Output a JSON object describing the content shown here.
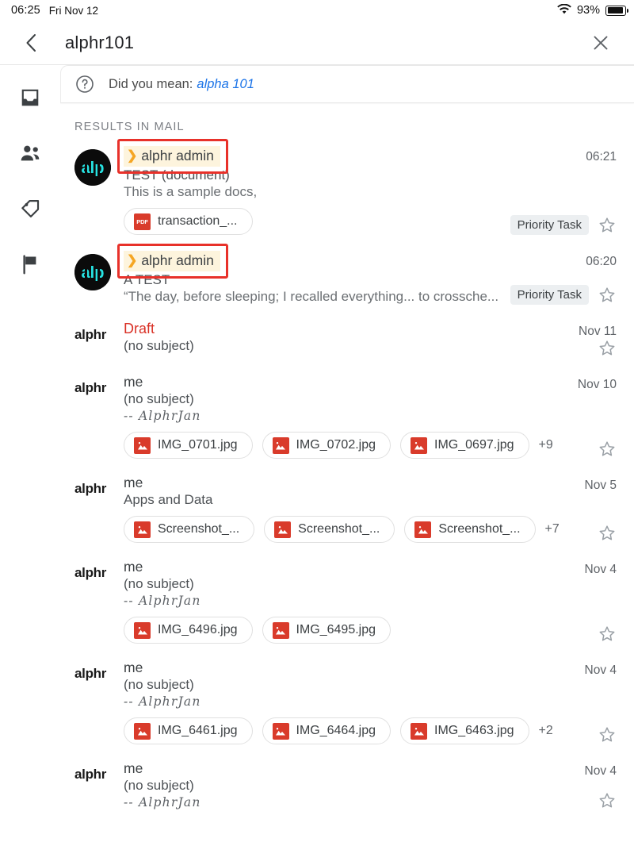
{
  "status_bar": {
    "time": "06:25",
    "date": "Fri Nov 12",
    "battery_percent": "93%",
    "wifi_icon": "wifi-icon",
    "battery_icon": "battery-icon"
  },
  "search_header": {
    "back_icon": "back-chevron-icon",
    "query": "alphr101",
    "close_icon": "close-x-icon"
  },
  "rail": {
    "items": [
      {
        "icon": "inbox-icon",
        "label": "Inbox"
      },
      {
        "icon": "contacts-icon",
        "label": "Contacts"
      },
      {
        "icon": "tag-icon",
        "label": "Labels"
      },
      {
        "icon": "flag-icon",
        "label": "Flagged"
      }
    ]
  },
  "suggestion": {
    "help_icon": "question-circle-icon",
    "label": "Did you mean:",
    "link": "alpha 101"
  },
  "results": {
    "section_title": "Results in Mail",
    "rows": [
      {
        "avatar_type": "image",
        "avatar_text": "alp",
        "sender": "alphr admin",
        "highlighted": true,
        "chevron": "❯",
        "subject": "TEST (document)",
        "snippet": "This is a sample docs,",
        "signature": "",
        "date": "06:21",
        "badge": "Priority Task",
        "star_icon": "star-outline-icon",
        "attachments": [
          {
            "name": "transaction_...",
            "type": "pdf",
            "icon_label": "PDF"
          }
        ],
        "more_count": ""
      },
      {
        "avatar_type": "image",
        "avatar_text": "alp",
        "sender": "alphr admin",
        "highlighted": true,
        "chevron": "❯",
        "subject": "A TEST",
        "snippet": "“The day, before sleeping; I recalled everything... to crossche...",
        "signature": "",
        "date": "06:20",
        "badge": "Priority Task",
        "star_icon": "star-outline-icon",
        "attachments": [],
        "more_count": ""
      },
      {
        "avatar_type": "text",
        "avatar_text": "alphr",
        "sender": "Draft",
        "sender_style": "draft",
        "highlighted": false,
        "subject": "(no subject)",
        "snippet": "",
        "signature": "",
        "date": "Nov 11",
        "badge": "",
        "star_icon": "star-outline-icon",
        "attachments": [],
        "more_count": ""
      },
      {
        "avatar_type": "text",
        "avatar_text": "alphr",
        "sender": "me",
        "highlighted": false,
        "subject": "(no subject)",
        "snippet": "",
        "signature": "-- AlphrJan",
        "date": "Nov 10",
        "badge": "",
        "star_icon": "star-outline-icon",
        "attachments": [
          {
            "name": "IMG_0701.jpg",
            "type": "image",
            "icon_label": ""
          },
          {
            "name": "IMG_0702.jpg",
            "type": "image",
            "icon_label": ""
          },
          {
            "name": "IMG_0697.jpg",
            "type": "image",
            "icon_label": ""
          }
        ],
        "more_count": "+9"
      },
      {
        "avatar_type": "text",
        "avatar_text": "alphr",
        "sender": "me",
        "highlighted": false,
        "subject": "Apps and Data",
        "snippet": "",
        "signature": "",
        "date": "Nov 5",
        "badge": "",
        "star_icon": "star-outline-icon",
        "attachments": [
          {
            "name": "Screenshot_...",
            "type": "image",
            "icon_label": ""
          },
          {
            "name": "Screenshot_...",
            "type": "image",
            "icon_label": ""
          },
          {
            "name": "Screenshot_...",
            "type": "image",
            "icon_label": ""
          }
        ],
        "more_count": "+7"
      },
      {
        "avatar_type": "text",
        "avatar_text": "alphr",
        "sender": "me",
        "highlighted": false,
        "subject": "(no subject)",
        "snippet": "",
        "signature": "-- AlphrJan",
        "date": "Nov 4",
        "badge": "",
        "star_icon": "star-outline-icon",
        "attachments": [
          {
            "name": "IMG_6496.jpg",
            "type": "image",
            "icon_label": ""
          },
          {
            "name": "IMG_6495.jpg",
            "type": "image",
            "icon_label": ""
          }
        ],
        "more_count": ""
      },
      {
        "avatar_type": "text",
        "avatar_text": "alphr",
        "sender": "me",
        "highlighted": false,
        "subject": "(no subject)",
        "snippet": "",
        "signature": "-- AlphrJan",
        "date": "Nov 4",
        "badge": "",
        "star_icon": "star-outline-icon",
        "attachments": [
          {
            "name": "IMG_6461.jpg",
            "type": "image",
            "icon_label": ""
          },
          {
            "name": "IMG_6464.jpg",
            "type": "image",
            "icon_label": ""
          },
          {
            "name": "IMG_6463.jpg",
            "type": "image",
            "icon_label": ""
          }
        ],
        "more_count": "+2"
      },
      {
        "avatar_type": "text",
        "avatar_text": "alphr",
        "sender": "me",
        "highlighted": false,
        "subject": "(no subject)",
        "snippet": "",
        "signature": "-- AlphrJan",
        "date": "Nov 4",
        "badge": "",
        "star_icon": "star-outline-icon",
        "attachments": [],
        "more_count": ""
      }
    ]
  },
  "colors": {
    "link": "#1a73e8",
    "draft_red": "#d93025",
    "annotation_red": "#e8312a",
    "highlight_yellow": "#fdf4dd",
    "chevron_orange": "#f5a623",
    "attachment_red": "#d93b2b",
    "avatar_cyan": "#27e3e3"
  }
}
